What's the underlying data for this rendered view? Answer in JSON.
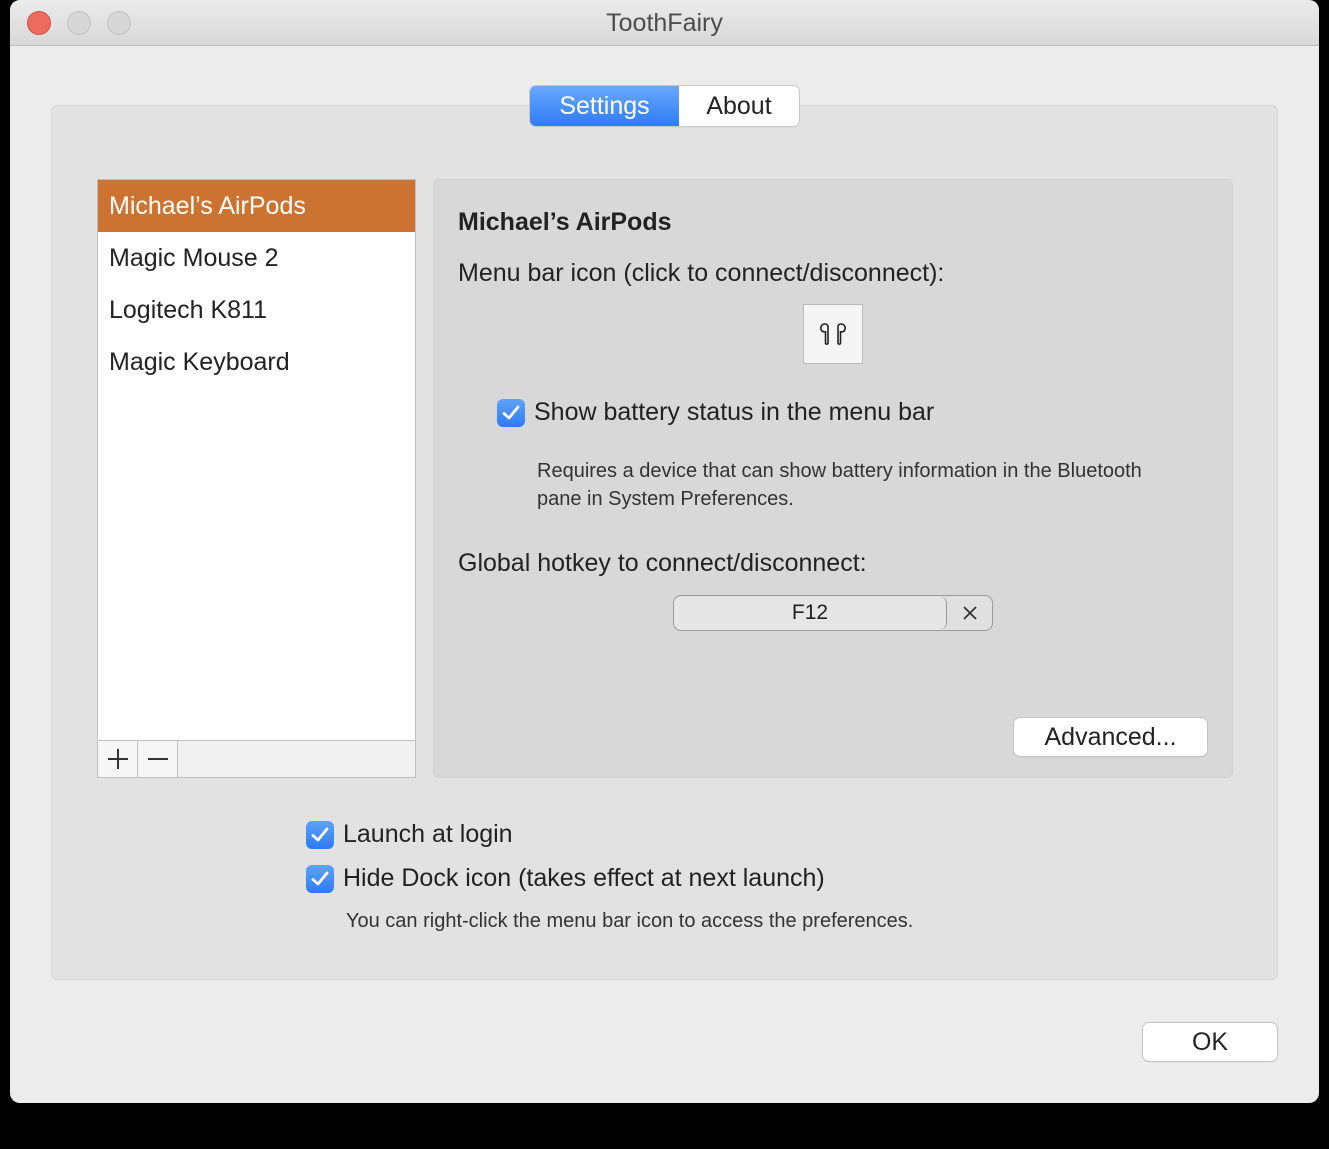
{
  "window": {
    "title": "ToothFairy"
  },
  "tabs": [
    {
      "label": "Settings",
      "selected": true
    },
    {
      "label": "About",
      "selected": false
    }
  ],
  "devices": {
    "items": [
      {
        "label": "Michael’s AirPods",
        "selected": true
      },
      {
        "label": "Magic Mouse 2",
        "selected": false
      },
      {
        "label": "Logitech K811",
        "selected": false
      },
      {
        "label": "Magic Keyboard",
        "selected": false
      }
    ],
    "add_label": "+",
    "remove_label": "—"
  },
  "detail": {
    "title": "Michael’s AirPods",
    "menu_bar_icon_label": "Menu bar icon (click to connect/disconnect):",
    "menu_bar_icon": "airpods-icon",
    "show_battery_label": "Show battery status in the menu bar",
    "show_battery_checked": true,
    "battery_hint": "Requires a device that can show battery information in the Bluetooth pane in System Preferences.",
    "hotkey_label": "Global hotkey to connect/disconnect:",
    "hotkey_value": "F12",
    "advanced_label": "Advanced..."
  },
  "general": {
    "launch_at_login_label": "Launch at login",
    "launch_at_login_checked": true,
    "hide_dock_label": "Hide Dock icon (takes effect at next launch)",
    "hide_dock_checked": true,
    "dock_hint": "You can right-click the menu bar icon to access the preferences."
  },
  "footer": {
    "ok_label": "OK"
  },
  "colors": {
    "selection": "#cc7331",
    "accent": "#2d7cf5",
    "close_button": "#ed6a5e"
  }
}
